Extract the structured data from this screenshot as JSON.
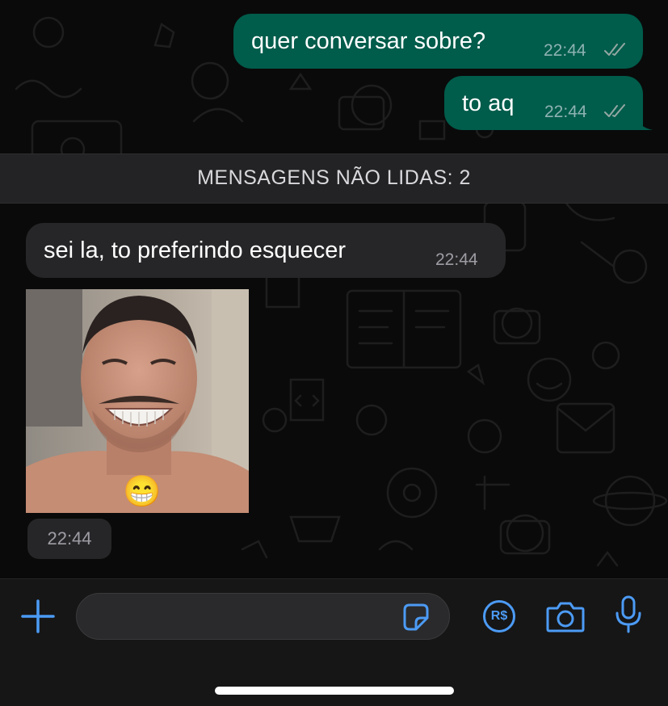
{
  "colors": {
    "outgoing_bubble": "#005c4b",
    "incoming_bubble": "#262628",
    "accent": "#4c9bf5",
    "background": "#0a0a0a"
  },
  "messages": {
    "out1": {
      "text": "quer conversar sobre?",
      "time": "22:44",
      "status": "read"
    },
    "out2": {
      "text": "to aq",
      "time": "22:44",
      "status": "read"
    },
    "unread_banner": "MENSAGENS NÃO LIDAS: 2",
    "in1": {
      "text": "sei la, to preferindo esquecer",
      "time": "22:44"
    },
    "photo": {
      "time": "22:44",
      "sticker": "😁"
    }
  },
  "composer": {
    "add_icon": "plus-icon",
    "sticker_icon": "sticker-icon",
    "payment_label": "R$",
    "camera_icon": "camera-icon",
    "mic_icon": "microphone-icon"
  }
}
